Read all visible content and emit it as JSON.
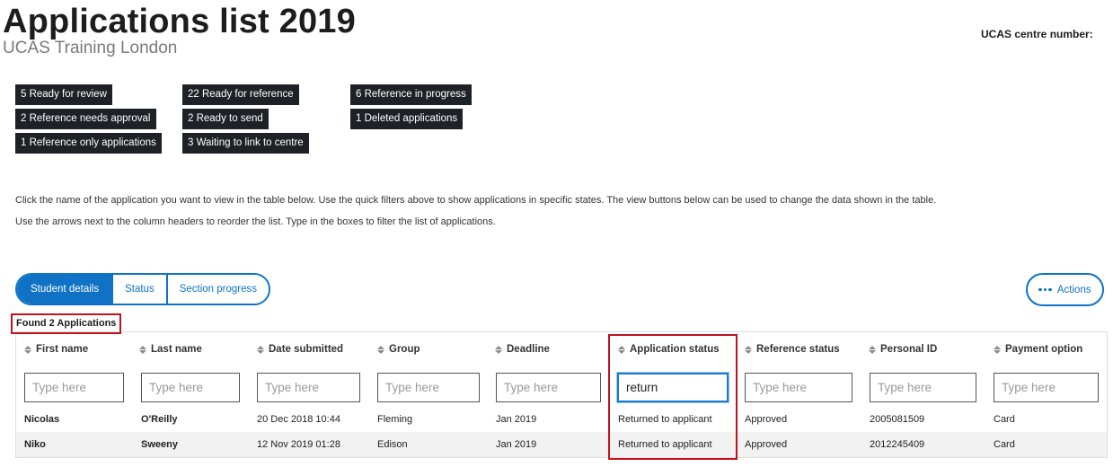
{
  "header": {
    "title": "Applications list 2019",
    "subtitle": "UCAS Training London",
    "centre_label": "UCAS centre number:"
  },
  "quick_filters": [
    "5 Ready for review",
    "22 Ready for reference",
    "6 Reference in progress",
    "2 Reference needs approval",
    "2 Ready to send",
    "1 Deleted applications",
    "1 Reference only applications",
    "3 Waiting to link to centre"
  ],
  "help": {
    "line1": "Click the name of the application you want to view in the table below. Use the quick filters above to show applications in specific states. The view buttons below can be used to change the data shown in the table.",
    "line2": "Use the arrows next to the column headers to reorder the list. Type in the boxes to filter the list of applications."
  },
  "views": {
    "tabs": [
      "Student details",
      "Status",
      "Section progress"
    ],
    "active": "Student details"
  },
  "actions_label": "Actions",
  "results": {
    "found_text": "Found 2 Applications"
  },
  "table": {
    "columns": [
      "First name",
      "Last name",
      "Date submitted",
      "Group",
      "Deadline",
      "Application status",
      "Reference status",
      "Personal ID",
      "Payment option"
    ],
    "filter_placeholder": "Type here",
    "filters": [
      "",
      "",
      "",
      "",
      "",
      "return",
      "",
      "",
      ""
    ],
    "rows": [
      [
        "Nicolas",
        "O'Reilly",
        "20 Dec 2018 10:44",
        "Fleming",
        "Jan 2019",
        "Returned to applicant",
        "Approved",
        "2005081509",
        "Card"
      ],
      [
        "Niko",
        "Sweeny",
        "12 Nov 2019 01:28",
        "Edison",
        "Jan 2019",
        "Returned to applicant",
        "Approved",
        "2012245409",
        "Card"
      ]
    ]
  },
  "colors": {
    "accent": "#0f72c5",
    "chip_bg": "#1e2227",
    "highlight": "#c1121f",
    "row_alt": "#f2f2f2"
  }
}
